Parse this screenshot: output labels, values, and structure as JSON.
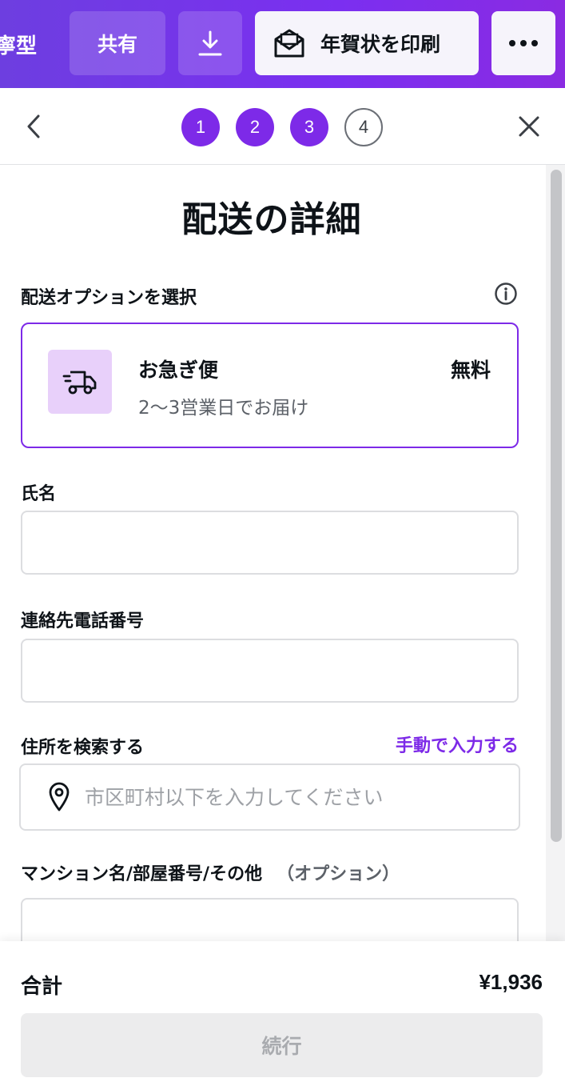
{
  "toolbar": {
    "partial_label": "寧型",
    "share_label": "共有",
    "download_icon": "download-icon",
    "print_label": "年賀状を印刷",
    "print_icon": "envelope-icon",
    "more_icon": "more-dots-icon",
    "gradient_colors": [
      "#6d3ee0",
      "#8a2be2"
    ]
  },
  "stepper": {
    "steps": [
      {
        "label": "1",
        "state": "done"
      },
      {
        "label": "2",
        "state": "done"
      },
      {
        "label": "3",
        "state": "done"
      },
      {
        "label": "4",
        "state": "todo"
      }
    ],
    "back_icon": "chevron-left-icon",
    "close_icon": "close-icon",
    "accent_color": "#7d2ae8"
  },
  "main": {
    "title": "配送の詳細",
    "shipping_section_label": "配送オプションを選択",
    "shipping_option": {
      "name": "お急ぎ便",
      "description": "2〜3営業日でお届け",
      "price": "無料",
      "icon": "truck-icon"
    },
    "name_label": "氏名",
    "name_value": "",
    "phone_label": "連絡先電話番号",
    "phone_value": "",
    "address_label": "住所を検索する",
    "manual_entry_link": "手動で入力する",
    "address_placeholder": "市区町村以下を入力してください",
    "building_label": "マンション名/部屋番号/その他",
    "building_optional": "（オプション）",
    "building_value": ""
  },
  "footer": {
    "total_label": "合計",
    "total_amount": "¥1,936",
    "continue_label": "続行"
  }
}
